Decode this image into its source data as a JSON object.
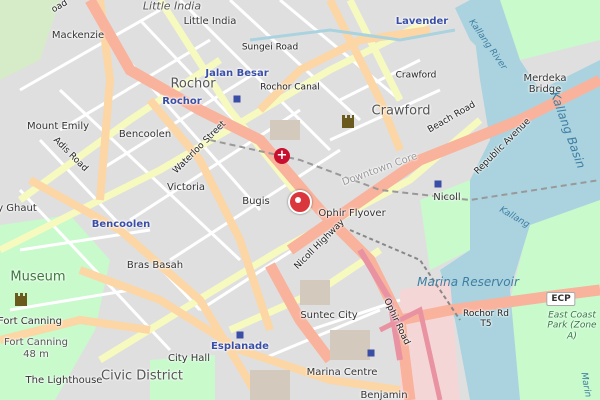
{
  "map": {
    "labels": {
      "little_india_top": "Little India",
      "little_india": "Little India",
      "mackenzie": "Mackenzie",
      "sungei_road": "Sungei Road",
      "lavender": "Lavender",
      "kallang_river": "Kallang River",
      "rochor_big": "Rochor",
      "jalan_besar": "Jalan Besar",
      "rochor_station": "Rochor",
      "rochor_canal": "Rochor Canal",
      "crawford_road": "Crawford",
      "crawford_area": "Crawford",
      "merdeka_bridge": "Merdeka\nBridge",
      "kallang_basin": "Kallang Basin",
      "mount_emily": "Mount Emily",
      "adis_road": "Adis Road",
      "bencoolen_road": "Bencoolen",
      "waterloo_street": "Waterloo Street",
      "beach_road": "Beach Road",
      "republic_avenue": "Republic Avenue",
      "downtown_core": "Downtown Core",
      "victoria": "Victoria",
      "bugis": "Bugis",
      "ophir_flyover": "Ophir Flyover",
      "nicoll": "Nicoll",
      "kallang_small": "Kallang",
      "bukit_ghaut": "y Ghaut",
      "bencoolen_station": "Bencoolen",
      "nicoll_highway": "Nicoll Highway",
      "museum": "Museum",
      "bras_basah": "Bras Basah",
      "marina_reservoir": "Marina Reservoir",
      "ecp": "ECP",
      "fort_canning": "Fort Canning",
      "fort_canning_hill": "Fort Canning",
      "fort_canning_height": "48 m",
      "suntec_city": "Suntec City",
      "ophir_road": "Ophir Road",
      "rochor_rd_t5": "Rochor Rd\nT5",
      "east_coast_park": "East Coast\nPark (Zone\nA)",
      "esplanade": "Esplanade",
      "city_hall": "City Hall",
      "the_lighthouse": "The Lighthouse",
      "civic_district": "Civic District",
      "marina_centre": "Marina Centre",
      "benjamin": "Benjamin",
      "marina_bay_partial": "Marin",
      "top_left_road": "oad"
    },
    "icons": [
      "hospital-icon",
      "location-pin-icon",
      "castle-icon",
      "fort-icon",
      "mrt-station-icon"
    ],
    "colors": {
      "land": "#f2efe9",
      "water": "#aad3df",
      "park": "#c8facc",
      "primary_road": "#fcd6a4",
      "trunk_road": "#f9b29c",
      "secondary_road": "#f7fabf",
      "marker": "#d9363e"
    }
  }
}
